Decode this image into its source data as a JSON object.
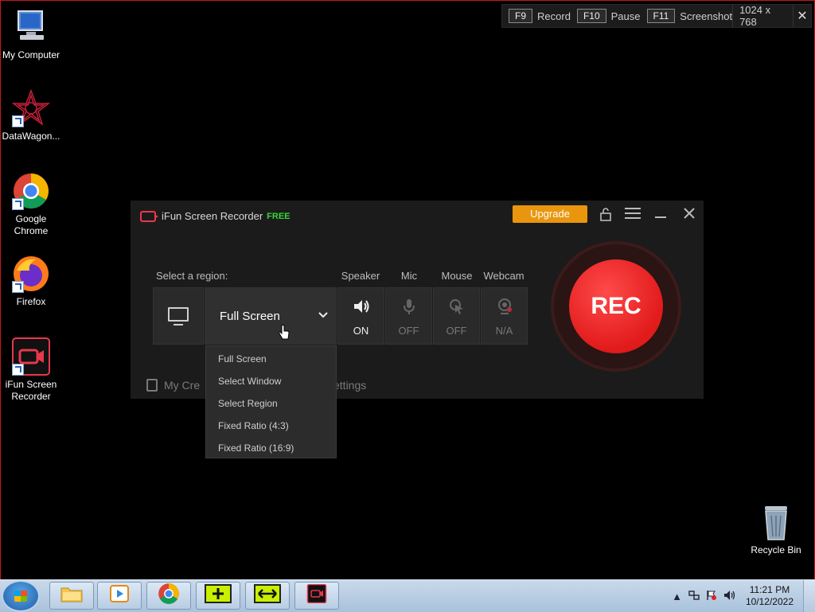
{
  "desktop": {
    "icons": [
      {
        "label": "My Computer",
        "icon": "computer-icon"
      },
      {
        "label": "DataWagon...",
        "icon": "datawagon-icon"
      },
      {
        "label": "Google Chrome",
        "icon": "chrome-icon"
      },
      {
        "label": "Firefox",
        "icon": "firefox-icon"
      },
      {
        "label": "iFun Screen Recorder",
        "icon": "ifun-recorder-icon"
      },
      {
        "label": "Recycle Bin",
        "icon": "recycle-bin-icon"
      }
    ]
  },
  "hotkeys": {
    "record_key": "F9",
    "record_label": "Record",
    "pause_key": "F10",
    "pause_label": "Pause",
    "screenshot_key": "F11",
    "screenshot_label": "Screenshot",
    "resolution": "1024 x 768",
    "close": "✕"
  },
  "recorder": {
    "app_name": "iFun Screen Recorder",
    "edition": "FREE",
    "upgrade_label": "Upgrade",
    "region_label": "Select a region:",
    "region_value": "Full Screen",
    "columns": {
      "speaker": {
        "label": "Speaker",
        "state": "ON"
      },
      "mic": {
        "label": "Mic",
        "state": "OFF"
      },
      "mouse": {
        "label": "Mouse",
        "state": "OFF"
      },
      "webcam": {
        "label": "Webcam",
        "state": "N/A"
      }
    },
    "rec_label": "REC",
    "my_creations_partial": "My Cre",
    "settings_partial": "ettings",
    "menu_items": [
      "Full Screen",
      "Select Window",
      "Select Region",
      "Fixed Ratio (4:3)",
      "Fixed Ratio (16:9)"
    ]
  },
  "taskbar": {
    "time": "11:21 PM",
    "date": "10/12/2022"
  },
  "colors": {
    "accent_red": "#e8384a",
    "rec_red": "#ff2a2a",
    "upgrade_orange": "#e9960e",
    "free_green": "#37d637"
  }
}
